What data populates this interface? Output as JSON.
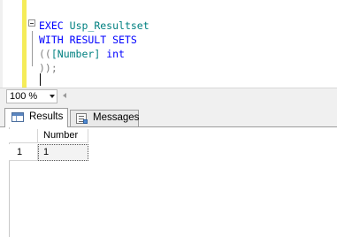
{
  "editor": {
    "line1": {
      "keyword": "EXEC",
      "identifier": "Usp_Resultset"
    },
    "line2": {
      "text": "WITH RESULT SETS"
    },
    "line3": {
      "open": "((",
      "column": "[Number]",
      "type": "int"
    },
    "line4": {
      "text": "));"
    }
  },
  "zoom": {
    "value": "100 %"
  },
  "tabs": [
    {
      "label": "Results",
      "icon": "results-grid-icon",
      "selected": true
    },
    {
      "label": "Messages",
      "icon": "messages-icon",
      "selected": false
    }
  ],
  "results": {
    "columns": [
      "Number"
    ],
    "rows": [
      {
        "rownum": "1",
        "cells": [
          "1"
        ]
      }
    ]
  },
  "colors": {
    "keyword": "#0000ff",
    "identifier": "#008080",
    "operator": "#808080",
    "change_bar": "#f5ec58"
  }
}
